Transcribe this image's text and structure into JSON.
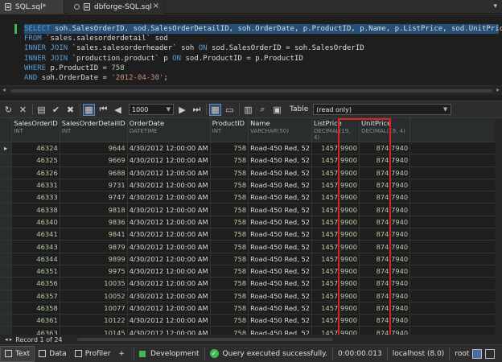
{
  "tabs": [
    {
      "label": "SQL.sql*",
      "icon": "sql-file-icon"
    },
    {
      "label": "dbforge-SQL.sql",
      "icon": "pin-icon"
    }
  ],
  "editor": {
    "lines": [
      "SELECT soh.SalesOrderID, sod.SalesOrderDetailID, soh.OrderDate, p.ProductID, p.Name, p.ListPrice, sod.UnitPrice",
      "FROM `sales.salesorderdetail` sod",
      "INNER JOIN `sales.salesorderheader` soh ON sod.SalesOrderID = soh.SalesOrderID",
      "INNER JOIN `production.product` p ON sod.ProductID = p.ProductID",
      "WHERE p.ProductID = 758",
      "AND soh.OrderDate = '2012-04-30';"
    ]
  },
  "toolbar": {
    "page_size": "1000",
    "table_label": "Table",
    "table_value": "(read only)"
  },
  "grid": {
    "columns": [
      {
        "name": "SalesOrderID",
        "type": "INT"
      },
      {
        "name": "SalesOrderDetailID",
        "type": "INT"
      },
      {
        "name": "OrderDate",
        "type": "DATETIME"
      },
      {
        "name": "ProductID",
        "type": "INT"
      },
      {
        "name": "Name",
        "type": "VARCHAR(50)"
      },
      {
        "name": "ListPrice",
        "type": "DECIMAL(19, 4)"
      },
      {
        "name": "UnitPrice",
        "type": "DECIMAL(19, 4)"
      }
    ],
    "rows": [
      [
        "46324",
        "9644",
        "4/30/2012 12:00:00 AM",
        "758",
        "Road-450 Red, 52",
        "1457.9900",
        "874.7940"
      ],
      [
        "46325",
        "9669",
        "4/30/2012 12:00:00 AM",
        "758",
        "Road-450 Red, 52",
        "1457.9900",
        "874.7940"
      ],
      [
        "46326",
        "9688",
        "4/30/2012 12:00:00 AM",
        "758",
        "Road-450 Red, 52",
        "1457.9900",
        "874.7940"
      ],
      [
        "46331",
        "9731",
        "4/30/2012 12:00:00 AM",
        "758",
        "Road-450 Red, 52",
        "1457.9900",
        "874.7940"
      ],
      [
        "46333",
        "9747",
        "4/30/2012 12:00:00 AM",
        "758",
        "Road-450 Red, 52",
        "1457.9900",
        "874.7940"
      ],
      [
        "46338",
        "9818",
        "4/30/2012 12:00:00 AM",
        "758",
        "Road-450 Red, 52",
        "1457.9900",
        "874.7940"
      ],
      [
        "46340",
        "9836",
        "4/30/2012 12:00:00 AM",
        "758",
        "Road-450 Red, 52",
        "1457.9900",
        "874.7940"
      ],
      [
        "46341",
        "9841",
        "4/30/2012 12:00:00 AM",
        "758",
        "Road-450 Red, 52",
        "1457.9900",
        "874.7940"
      ],
      [
        "46343",
        "9879",
        "4/30/2012 12:00:00 AM",
        "758",
        "Road-450 Red, 52",
        "1457.9900",
        "874.7940"
      ],
      [
        "46344",
        "9899",
        "4/30/2012 12:00:00 AM",
        "758",
        "Road-450 Red, 52",
        "1457.9900",
        "874.7940"
      ],
      [
        "46351",
        "9975",
        "4/30/2012 12:00:00 AM",
        "758",
        "Road-450 Red, 52",
        "1457.9900",
        "874.7940"
      ],
      [
        "46356",
        "10035",
        "4/30/2012 12:00:00 AM",
        "758",
        "Road-450 Red, 52",
        "1457.9900",
        "874.7940"
      ],
      [
        "46357",
        "10052",
        "4/30/2012 12:00:00 AM",
        "758",
        "Road-450 Red, 52",
        "1457.9900",
        "874.7940"
      ],
      [
        "46358",
        "10077",
        "4/30/2012 12:00:00 AM",
        "758",
        "Road-450 Red, 52",
        "1457.9900",
        "874.7940"
      ],
      [
        "46361",
        "10122",
        "4/30/2012 12:00:00 AM",
        "758",
        "Road-450 Red, 52",
        "1457.9900",
        "874.7940"
      ],
      [
        "46363",
        "10145",
        "4/30/2012 12:00:00 AM",
        "758",
        "Road-450 Red, 52",
        "1457.9900",
        "874.7940"
      ],
      [
        "46366",
        "10189",
        "4/30/2012 12:00:00 AM",
        "758",
        "Road-450 Red, 52",
        "1457.9900",
        "874.7940"
      ],
      [
        "46367",
        "10191",
        "4/30/2012 12:00:00 AM",
        "758",
        "Road-450 Red, 52",
        "1457.9900",
        "874.7940"
      ]
    ],
    "record_status": "Record 1 of 24"
  },
  "statusbar": {
    "text_tab": "Text",
    "data_tab": "Data",
    "profiler_tab": "Profiler",
    "add": "+",
    "environment": "Development",
    "message": "Query executed successfully.",
    "elapsed": "0:00:00.013",
    "server": "localhost (8.0)",
    "user": "root"
  },
  "colors": {
    "highlight": "#e02020",
    "success": "#3fb94f",
    "selection": "#264f78"
  }
}
